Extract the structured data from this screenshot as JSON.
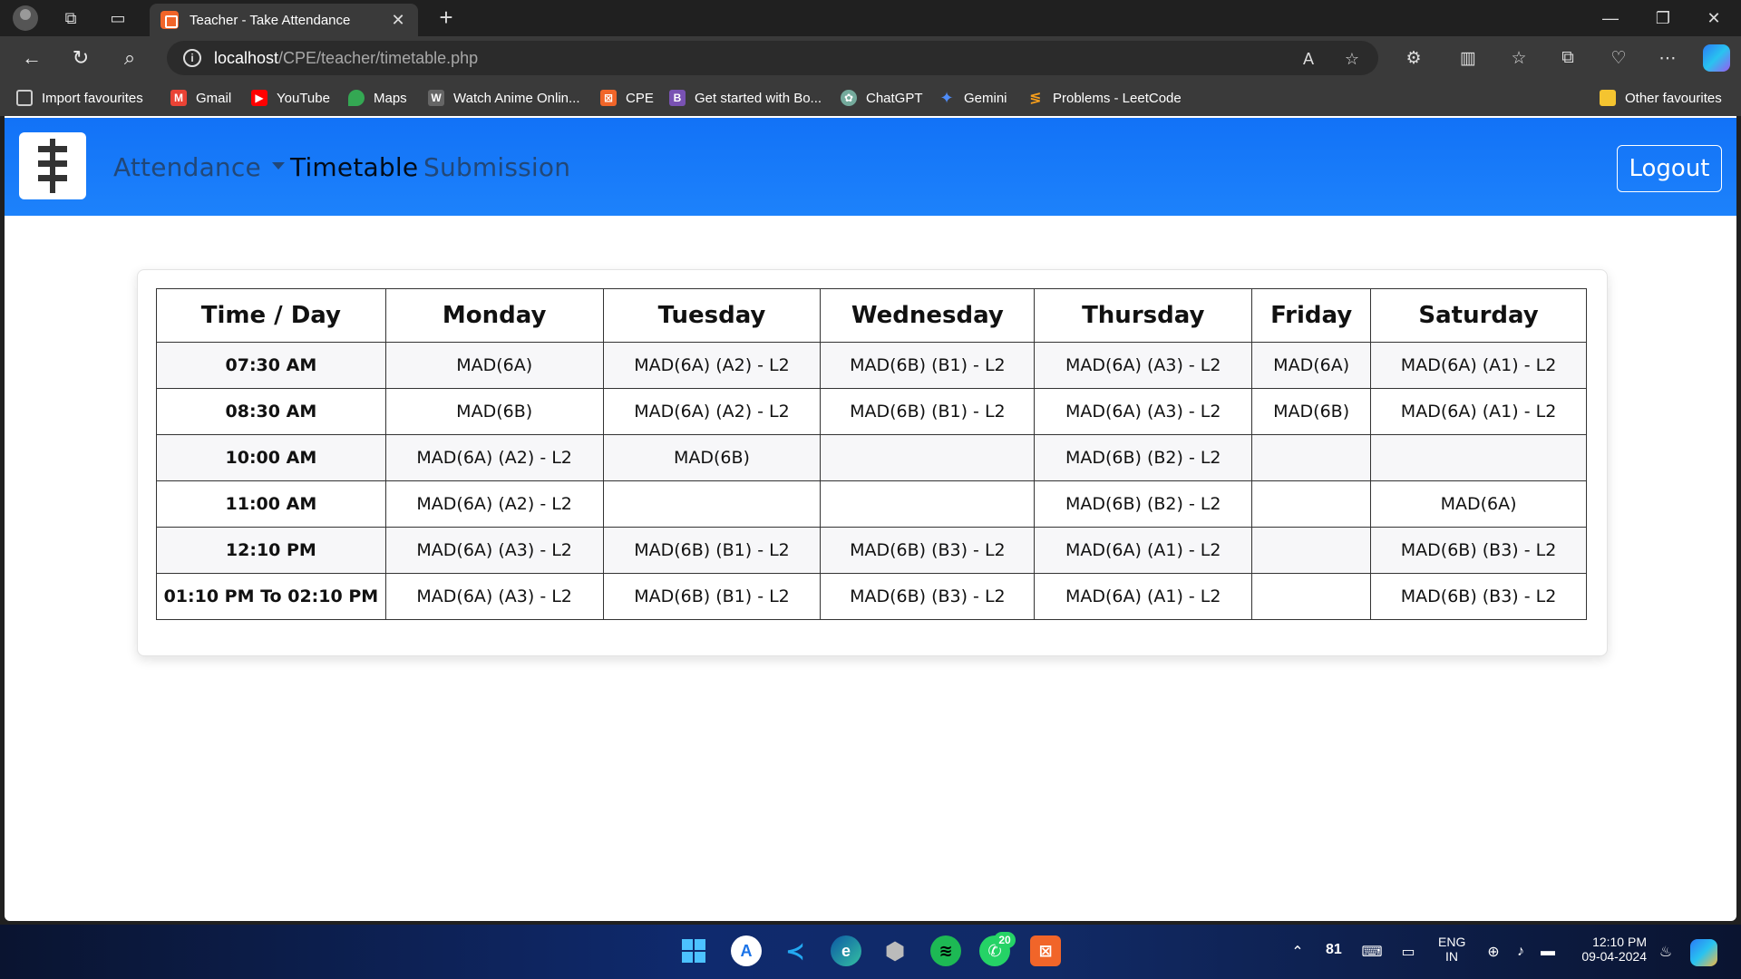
{
  "browser": {
    "tab_title": "Teacher - Take Attendance",
    "url_host": "localhost",
    "url_path": "/CPE/teacher/timetable.php",
    "favourites": [
      {
        "label": "Import favourites",
        "icon": "import-icon",
        "color": "#cccccc"
      },
      {
        "label": "Gmail",
        "icon": "gmail-icon",
        "color": "#ea4335"
      },
      {
        "label": "YouTube",
        "icon": "youtube-icon",
        "color": "#ff0000"
      },
      {
        "label": "Maps",
        "icon": "maps-icon",
        "color": "#34a853"
      },
      {
        "label": "Watch Anime Onlin...",
        "icon": "anime-site-icon",
        "color": "#bbbbbb"
      },
      {
        "label": "CPE",
        "icon": "xampp-icon",
        "color": "#f16529"
      },
      {
        "label": "Get started with Bo...",
        "icon": "bootstrap-icon",
        "color": "#7952b3"
      },
      {
        "label": "ChatGPT",
        "icon": "chatgpt-icon",
        "color": "#74aa9c"
      },
      {
        "label": "Gemini",
        "icon": "gemini-icon",
        "color": "#4f8cf7"
      },
      {
        "label": "Problems - LeetCode",
        "icon": "leetcode-icon",
        "color": "#f89f1b"
      }
    ],
    "other_favourites": "Other favourites"
  },
  "navbar": {
    "links": {
      "attendance": "Attendance",
      "timetable": "Timetable",
      "submission": "Submission"
    },
    "logout": "Logout",
    "accent": "#1a7cf8"
  },
  "timetable": {
    "headers": [
      "Time / Day",
      "Monday",
      "Tuesday",
      "Wednesday",
      "Thursday",
      "Friday",
      "Saturday"
    ],
    "rows": [
      [
        "07:30 AM",
        "MAD(6A)",
        "MAD(6A) (A2) - L2",
        "MAD(6B) (B1) - L2",
        "MAD(6A) (A3) - L2",
        "MAD(6A)",
        "MAD(6A) (A1) - L2"
      ],
      [
        "08:30 AM",
        "MAD(6B)",
        "MAD(6A) (A2) - L2",
        "MAD(6B) (B1) - L2",
        "MAD(6A) (A3) - L2",
        "MAD(6B)",
        "MAD(6A) (A1) - L2"
      ],
      [
        "10:00 AM",
        "MAD(6A) (A2) - L2",
        "MAD(6B)",
        "",
        "MAD(6B) (B2) - L2",
        "",
        ""
      ],
      [
        "11:00 AM",
        "MAD(6A) (A2) - L2",
        "",
        "",
        "MAD(6B) (B2) - L2",
        "",
        "MAD(6A)"
      ],
      [
        "12:10 PM",
        "MAD(6A) (A3) - L2",
        "MAD(6B) (B1) - L2",
        "MAD(6B) (B3) - L2",
        "MAD(6A) (A1) - L2",
        "",
        "MAD(6B) (B3) - L2"
      ],
      [
        "01:10 PM To 02:10 PM",
        "MAD(6A) (A3) - L2",
        "MAD(6B) (B1) - L2",
        "MAD(6B) (B3) - L2",
        "MAD(6A) (A1) - L2",
        "",
        "MAD(6B) (B3) - L2"
      ]
    ]
  },
  "taskbar": {
    "whatsapp_badge": "20",
    "battery": "81",
    "lang_1": "ENG",
    "lang_2": "IN",
    "time": "12:10 PM",
    "date": "09-04-2024"
  }
}
